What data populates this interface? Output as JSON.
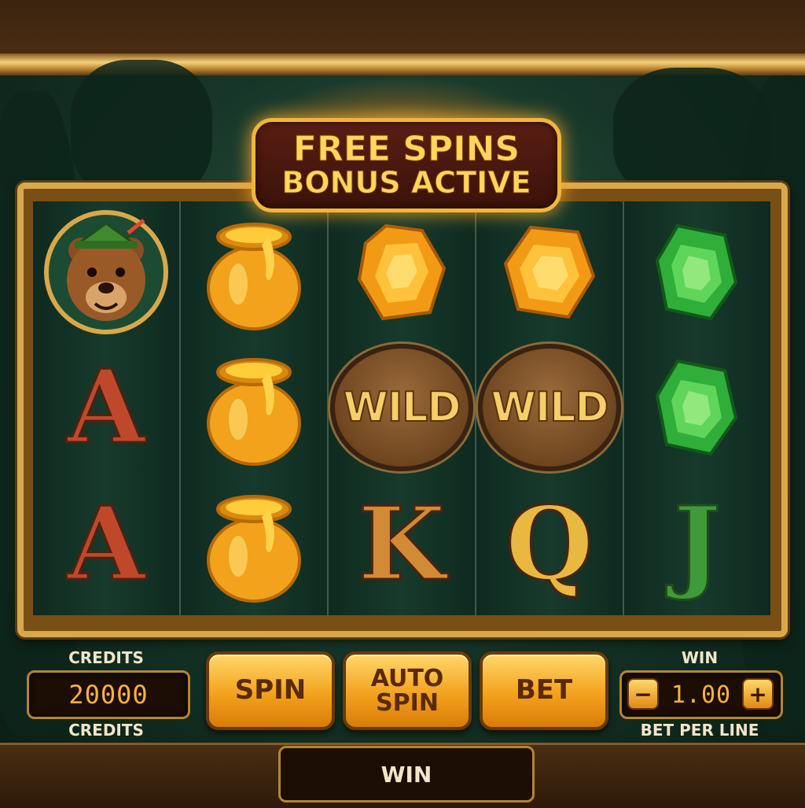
{
  "banner": {
    "line1": "FREE SPINS",
    "line2": "BONUS ACTIVE"
  },
  "reels": [
    {
      "symbols": [
        "bear",
        "A",
        "A"
      ]
    },
    {
      "symbols": [
        "honey-pot",
        "honey-pot",
        "honey-pot"
      ]
    },
    {
      "symbols": [
        "amber-gem",
        "WILD",
        "K"
      ]
    },
    {
      "symbols": [
        "amber-gem",
        "WILD",
        "Q"
      ]
    },
    {
      "symbols": [
        "green-gem",
        "green-gem",
        "J"
      ]
    }
  ],
  "symbol_text": {
    "wild": "WILD",
    "a": "A",
    "k": "K",
    "q": "Q",
    "j": "J"
  },
  "credits": {
    "label_top": "CREDITS",
    "value": "20000",
    "label_bottom": "CREDITS"
  },
  "buttons": {
    "spin": "SPIN",
    "auto_spin_1": "AUTO",
    "auto_spin_2": "SPIN",
    "bet": "BET"
  },
  "bet": {
    "label_top": "WIN",
    "value": "1.00",
    "minus": "−",
    "plus": "+",
    "label_bottom": "BET PER LINE"
  },
  "win_bar": {
    "label": "WIN"
  },
  "colors": {
    "gold": "#f0b63a",
    "frame": "#d9a84a",
    "felt": "#10291f",
    "lcd": "#ffb23a"
  }
}
